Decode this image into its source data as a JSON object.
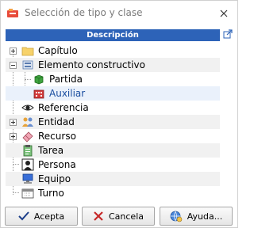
{
  "window": {
    "title": "Selección de tipo y clase"
  },
  "grid": {
    "header": "Descripción"
  },
  "tree": {
    "items": [
      {
        "label": "Capítulo",
        "icon": "folder-icon"
      },
      {
        "label": "Elemento constructivo",
        "icon": "component-icon"
      },
      {
        "label": "Partida",
        "icon": "green-cube-icon"
      },
      {
        "label": "Auxiliar",
        "icon": "red-building-icon"
      },
      {
        "label": "Referencia",
        "icon": "eye-icon"
      },
      {
        "label": "Entidad",
        "icon": "people-icon"
      },
      {
        "label": "Recurso",
        "icon": "eraser-icon"
      },
      {
        "label": "Tarea",
        "icon": "clipboard-icon"
      },
      {
        "label": "Persona",
        "icon": "person-card-icon"
      },
      {
        "label": "Equipo",
        "icon": "computer-icon"
      },
      {
        "label": "Turno",
        "icon": "calendar-icon"
      }
    ]
  },
  "buttons": {
    "accept": "Acepta",
    "cancel": "Cancela",
    "help": "Ayuda..."
  },
  "colors": {
    "header_bg": "#2d63b8",
    "selected_bg": "#eaf1fb",
    "selected_text": "#1b4ea0"
  }
}
